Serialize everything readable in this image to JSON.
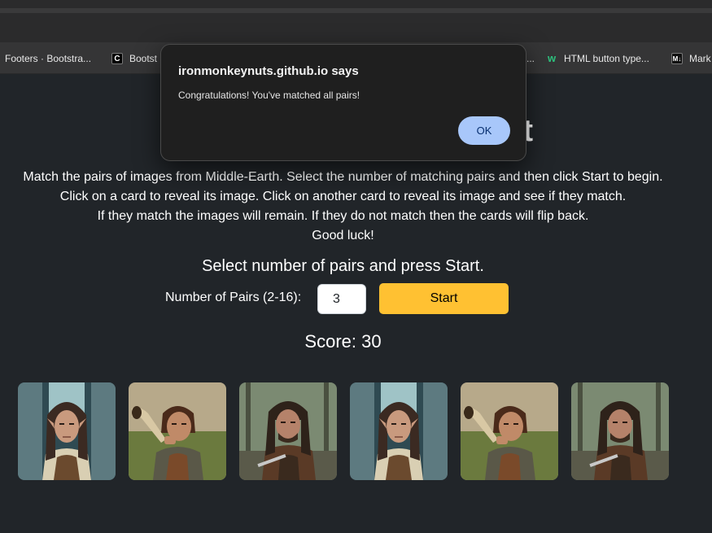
{
  "browser": {
    "bookmarks": [
      {
        "label": "Footers · Bootstra...",
        "icon": "none"
      },
      {
        "label": "Bootst",
        "icon": "c-logo-icon"
      },
      {
        "label": "...",
        "icon": "none"
      },
      {
        "label": "HTML button type...",
        "icon": "w3-logo-icon"
      },
      {
        "label": "Mark",
        "icon": "markdown-icon"
      }
    ]
  },
  "page": {
    "title": "M                                   st",
    "instructions": [
      "Match the pairs of images from Middle-Earth. Select the number of matching pairs and then click Start to begin.",
      "Click on a card to reveal its image. Click on another card to reveal its image and see if they match.",
      "If they match the images will remain. If they do not match then the cards will flip back.",
      "Good luck!"
    ],
    "select_heading": "Select number of pairs and press Start.",
    "pairs_label": "Number of Pairs (2-16):",
    "pairs_value": "3",
    "start_label": "Start",
    "score": "Score: 30",
    "cards": [
      {
        "character": "elf"
      },
      {
        "character": "horn-man"
      },
      {
        "character": "ranger"
      },
      {
        "character": "elf"
      },
      {
        "character": "horn-man"
      },
      {
        "character": "ranger"
      }
    ]
  },
  "dialog": {
    "title": "ironmonkeynuts.github.io says",
    "message": "Congratulations! You've matched all pairs!",
    "ok_label": "OK"
  },
  "colors": {
    "page_bg": "#212529",
    "start_button": "#ffc132",
    "ok_button": "#a8c7fa"
  }
}
